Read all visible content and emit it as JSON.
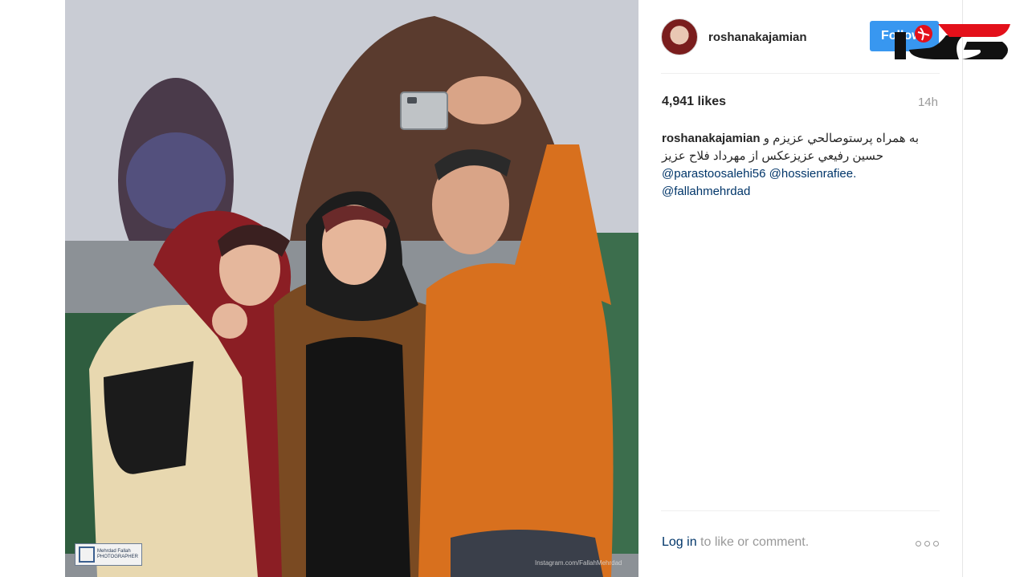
{
  "post": {
    "username": "roshanakajamian",
    "follow_label": "Follow",
    "likes": "4,941 likes",
    "time": "14h",
    "caption_user": "roshanakajamian",
    "caption_line1": "به همراه پرستوصالحي عزيزم و",
    "caption_line2": "حسين رفيعي عزيزعکس از مهرداد فلاح عزيز",
    "mentions": [
      "@parastoosalehi56",
      "@hossienrafiee.",
      "@fallahmehrdad"
    ],
    "login_link": "Log in",
    "login_rest": " to like or comment."
  },
  "photo": {
    "watermark_logo": "Mehrdad Fallah PHOTOGRAPHER",
    "watermark_text": "Instagram.com/FallahMehrdad"
  },
  "colors": {
    "follow": "#3897f0",
    "link": "#003569",
    "brand_red": "#e3101a"
  }
}
